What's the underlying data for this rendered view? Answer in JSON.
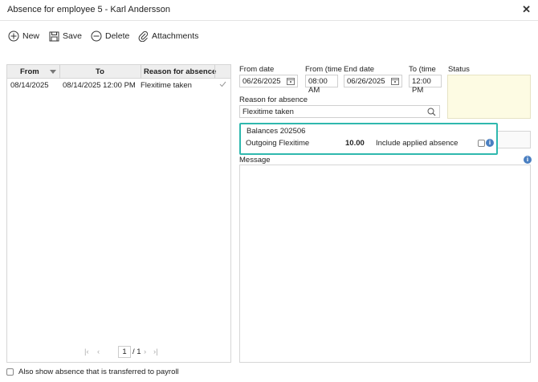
{
  "window": {
    "title": "Absence for employee 5 - Karl Andersson"
  },
  "toolbar": {
    "new_label": "New",
    "save_label": "Save",
    "delete_label": "Delete",
    "attachments_label": "Attachments"
  },
  "grid": {
    "headers": {
      "from": "From",
      "to": "To",
      "reason": "Reason for absence"
    },
    "rows": [
      {
        "from": "08/14/2025",
        "to": "08/14/2025 12:00 PM",
        "reason": "Flexitime taken"
      }
    ],
    "pager": {
      "current_page": "1",
      "total_pages": "/ 1"
    }
  },
  "form": {
    "from_date_label": "From date",
    "from_date_value": "06/26/2025",
    "from_time_label": "From (time",
    "from_time_value": "08:00 AM",
    "end_date_label": "End date",
    "end_date_value": "06/26/2025",
    "to_time_label": "To (time",
    "to_time_value": "12:00 PM",
    "status_label": "Status",
    "reason_label": "Reason for absence",
    "reason_value": "Flexitime taken"
  },
  "balances": {
    "title": "Balances 202506",
    "outgoing_label": "Outgoing Flexitime",
    "outgoing_value": "10.00",
    "include_label": "Include applied absence"
  },
  "message": {
    "label": "Message"
  },
  "footer": {
    "show_payroll_label": "Also show absence that is transferred to payroll"
  },
  "colors": {
    "highlight": "#2fb8ae",
    "info": "#4a7fc1",
    "status_bg": "#fdfbe3"
  }
}
